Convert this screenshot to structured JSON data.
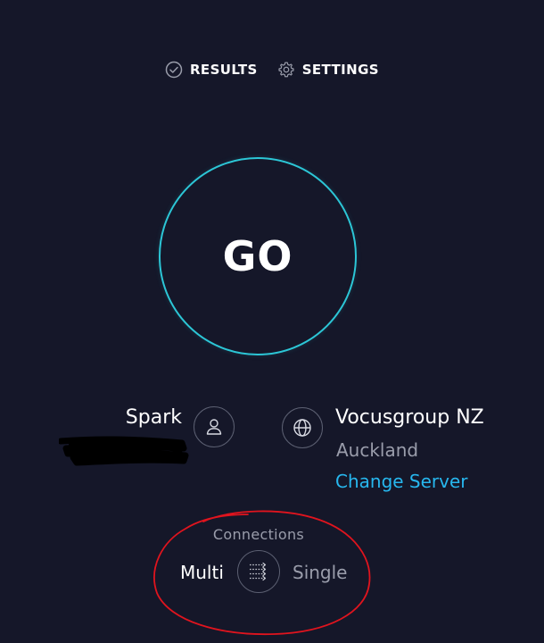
{
  "nav": {
    "results_label": "RESULTS",
    "settings_label": "SETTINGS"
  },
  "go": {
    "label": "GO",
    "ring_color": "#2cc6d6"
  },
  "isp": {
    "name": "Spark",
    "icon": "user-icon"
  },
  "server": {
    "name": "Vocusgroup NZ",
    "location": "Auckland",
    "change_label": "Change Server",
    "icon": "globe-icon",
    "link_color": "#27b7ee"
  },
  "connections": {
    "label": "Connections",
    "multi_label": "Multi",
    "single_label": "Single",
    "selected": "Multi",
    "icon": "connections-icon"
  },
  "colors": {
    "background": "#151729",
    "annotation": "#e0141e"
  }
}
